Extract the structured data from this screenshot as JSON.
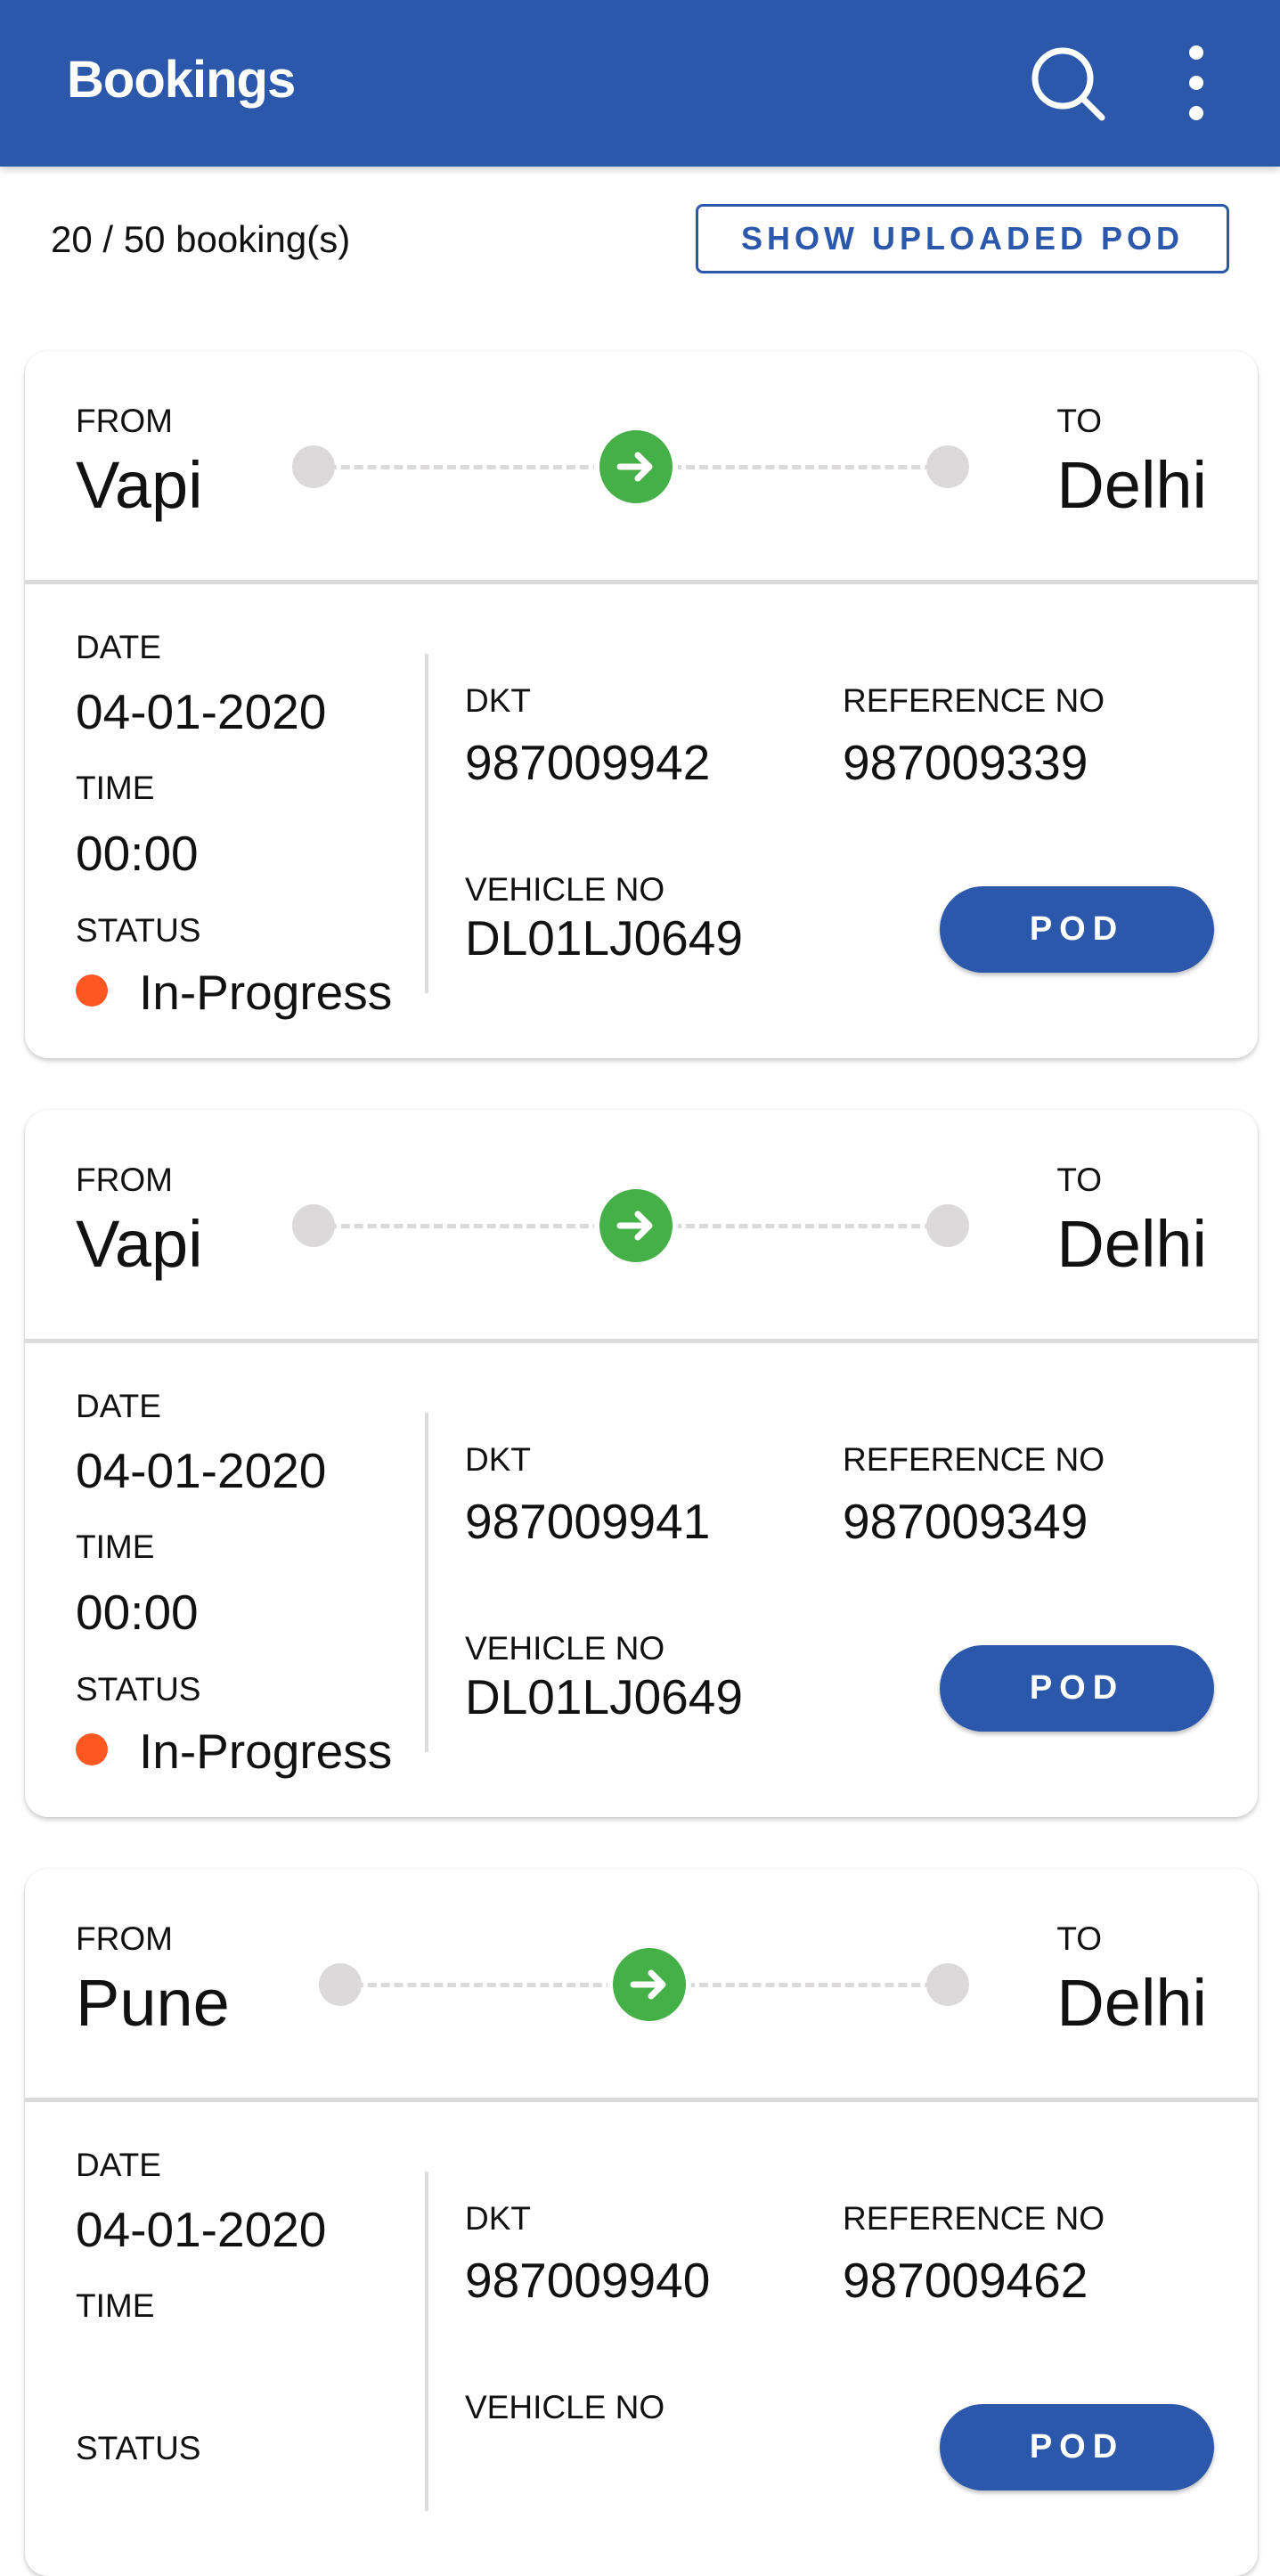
{
  "appbar": {
    "title": "Bookings",
    "icons": [
      "search-icon",
      "more-vert-icon"
    ]
  },
  "summary": {
    "count": "20 / 50 booking(s)",
    "show_uploaded_pod": "SHOW UPLOADED POD"
  },
  "labels": {
    "from": "FROM",
    "to": "TO",
    "date": "DATE",
    "time": "TIME",
    "status": "STATUS",
    "dkt": "DKT",
    "reference": "REFERENCE NO",
    "vehicle": "VEHICLE NO",
    "pod": "POD"
  },
  "colors": {
    "primary": "#2B58AB",
    "route_arrow": "#46B048",
    "status_in_progress": "#FF5722",
    "route_dot": "#DCD9DA"
  },
  "bookings": [
    {
      "from": "Vapi",
      "to": "Delhi",
      "date": "04-01-2020",
      "time": "00:00",
      "status": "In-Progress",
      "dkt": "987009942",
      "reference": "987009339",
      "vehicle": "DL01LJ0649"
    },
    {
      "from": "Vapi",
      "to": "Delhi",
      "date": "04-01-2020",
      "time": "00:00",
      "status": "In-Progress",
      "dkt": "987009941",
      "reference": "987009349",
      "vehicle": "DL01LJ0649"
    },
    {
      "from": "Pune",
      "to": "Delhi",
      "date": "04-01-2020",
      "dkt": "987009940",
      "reference": "987009462"
    }
  ]
}
